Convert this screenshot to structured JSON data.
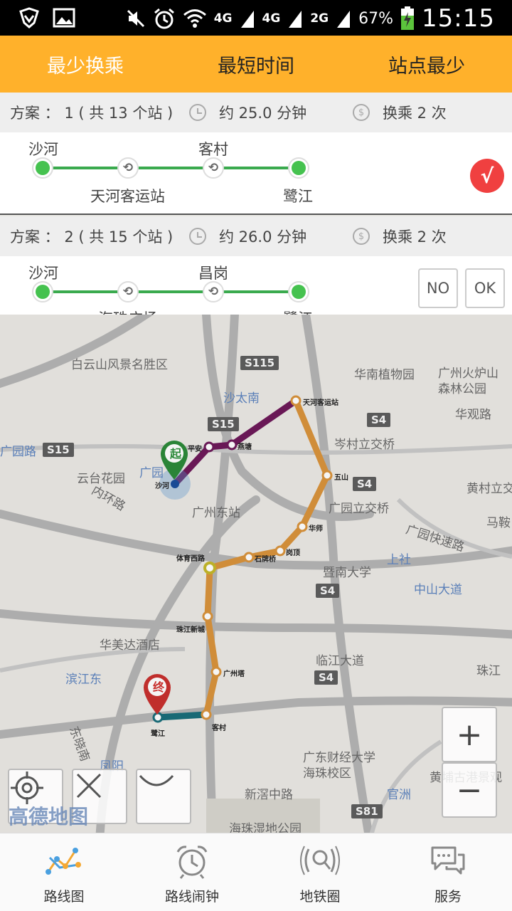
{
  "status_bar": {
    "network_1": "4G",
    "network_2": "4G",
    "network_3": "2G",
    "battery": "67%",
    "time": "15:15"
  },
  "tabs": [
    {
      "label": "最少换乘",
      "active": true
    },
    {
      "label": "最短时间",
      "active": false
    },
    {
      "label": "站点最少",
      "active": false
    }
  ],
  "plans": [
    {
      "title": "方案 ： 1 ( 共 13 个站 )",
      "time": "约 25.0 分钟",
      "transfer": "换乘 2 次",
      "top_labels": [
        "沙河",
        "客村"
      ],
      "bottom_labels": [
        "天河客运站",
        "鹭江"
      ],
      "selected_icon": "√"
    },
    {
      "title": "方案 ： 2 ( 共 15 个站 )",
      "time": "约 26.0 分钟",
      "transfer": "换乘 2 次",
      "top_labels": [
        "沙河",
        "昌岗"
      ],
      "bottom_labels": [
        "海珠广场",
        "鹭江"
      ],
      "buttons": [
        "NO",
        "OK"
      ]
    }
  ],
  "map": {
    "labels": [
      "白云山风景名胜区",
      "华南植物园",
      "广州火炉山森林公园",
      "沙太南",
      "岑村立交桥",
      "华观路",
      "广园路",
      "云台花园",
      "广园",
      "内环路",
      "广州东站",
      "广园立交桥",
      "黄村立交",
      "广园快速路",
      "马鞍",
      "上社",
      "暨南大学",
      "中山大道",
      "华美达酒店",
      "临江大道",
      "珠江",
      "滨江东",
      "东晓南",
      "凤阳",
      "广东财经大学海珠校区",
      "新滘中路",
      "官洲",
      "黄埔古港景观",
      "海珠湿地公园"
    ],
    "road_signs": [
      "S115",
      "S15",
      "S15",
      "S4",
      "S4",
      "S4",
      "S4",
      "S81"
    ],
    "stations": [
      "天河客运站",
      "平安",
      "燕塘",
      "沙河",
      "五山",
      "华师",
      "岗顶",
      "石牌桥",
      "体育西路",
      "珠江新城",
      "广州塔",
      "客村",
      "鹭江"
    ],
    "start_marker": "起",
    "end_marker": "终",
    "zoom_in": "+",
    "zoom_out": "−",
    "logo": "高德地图"
  },
  "bottom_nav": [
    {
      "label": "路线图",
      "icon": "route-map-icon"
    },
    {
      "label": "路线闹钟",
      "icon": "alarm-clock-icon"
    },
    {
      "label": "地铁圈",
      "icon": "metro-circle-icon"
    },
    {
      "label": "服务",
      "icon": "chat-bubbles-icon"
    }
  ],
  "colors": {
    "tab_bg": "#ffb12b",
    "route_green": "#3aaa4e",
    "line_purple": "#6e1a5a",
    "line_orange": "#d9933c",
    "line_teal": "#1a6e7a",
    "check_red": "#f04040"
  }
}
